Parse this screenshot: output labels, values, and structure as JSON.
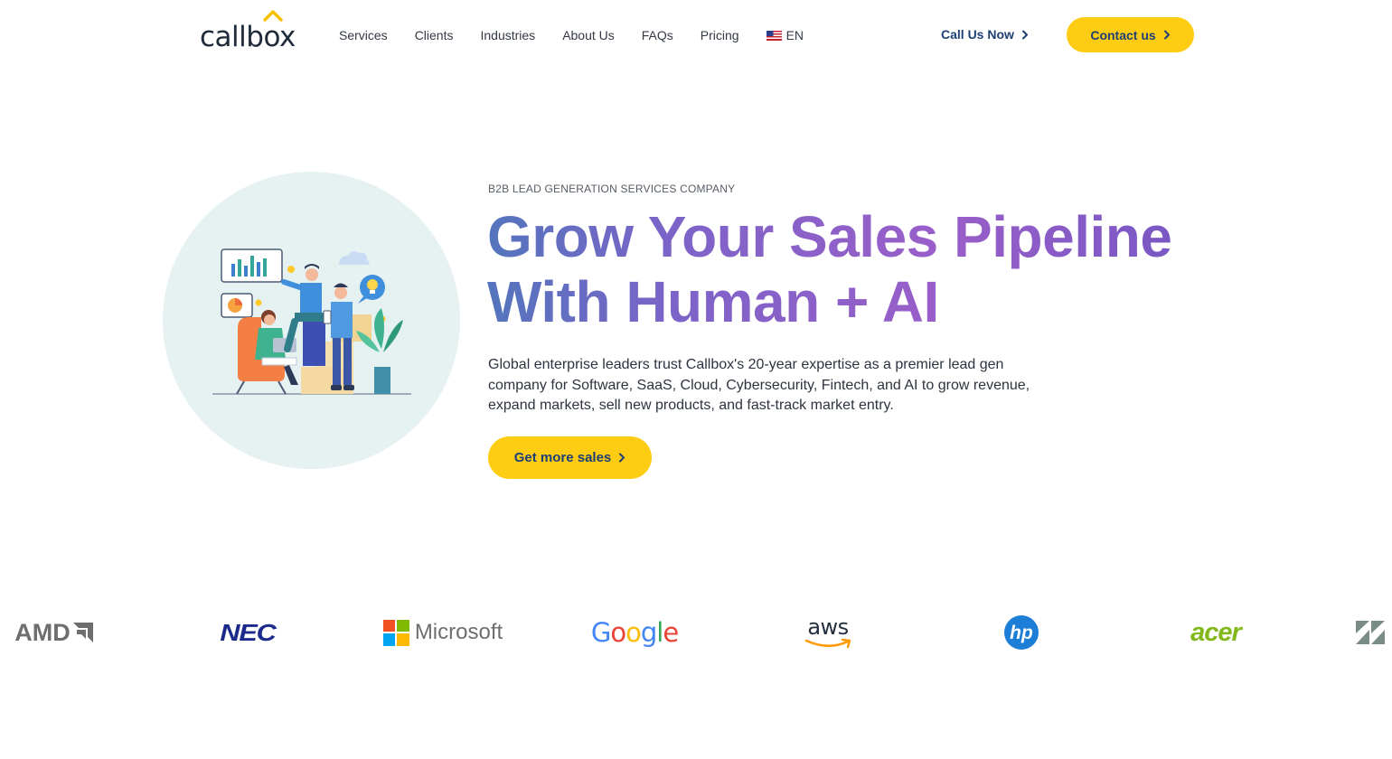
{
  "header": {
    "logo_text": "callbox",
    "nav": [
      "Services",
      "Clients",
      "Industries",
      "About Us",
      "FAQs",
      "Pricing"
    ],
    "language": "EN",
    "call_label": "Call Us Now",
    "contact_label": "Contact us"
  },
  "hero": {
    "eyebrow": "B2B LEAD GENERATION SERVICES COMPANY",
    "headline_line1": "Grow Your Sales Pipeline",
    "headline_line2": "With Human + AI",
    "description": "Global enterprise leaders trust Callbox's 20-year expertise as a premier lead gen company for Software, SaaS, Cloud, Cybersecurity, Fintech, and AI to grow revenue, expand markets, sell new products, and fast-track market entry.",
    "cta_label": "Get more sales"
  },
  "logos": {
    "amd": "AMD",
    "nec": "NEC",
    "microsoft": "Microsoft",
    "google": [
      "G",
      "o",
      "o",
      "g",
      "l",
      "e"
    ],
    "aws": "aws",
    "hp": "hp",
    "acer": "acer"
  },
  "colors": {
    "accent_yellow": "#ffcc14",
    "navy": "#1d3f73",
    "hero_circle": "#e6f1f2",
    "headline_gradient": [
      "#5475bd",
      "#9a5ec9"
    ]
  },
  "icons": [
    "callbox-caret-icon",
    "us-flag-icon",
    "chevron-right-icon",
    "microsoft-grid-icon",
    "aws-smile-icon",
    "hp-circle-icon",
    "zendesk-icon"
  ]
}
